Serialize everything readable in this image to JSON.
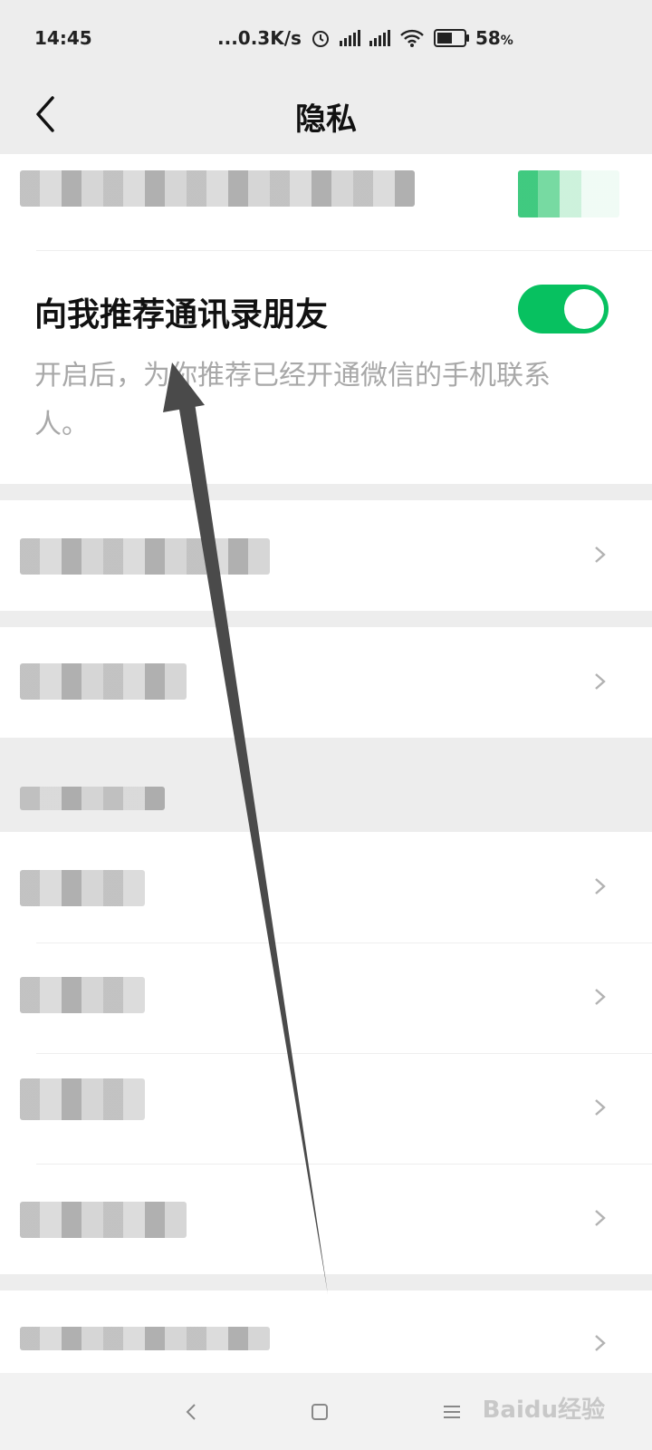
{
  "status_bar": {
    "time": "14:45",
    "network_speed": "...0.3K/s",
    "battery_percent": "58",
    "battery_unit": "%",
    "battery_level": 0.58,
    "icons": [
      "alarm-icon",
      "signal-icon",
      "signal-icon",
      "wifi-icon",
      "battery-icon"
    ]
  },
  "header": {
    "title": "隐私"
  },
  "recommend_contacts": {
    "label": "向我推荐通讯录朋友",
    "description": "开启后，为你推荐已经开通微信的手机联系人。",
    "enabled": true
  },
  "colors": {
    "accent": "#07c160",
    "background": "#ededed"
  },
  "watermark": "Baidu经验"
}
